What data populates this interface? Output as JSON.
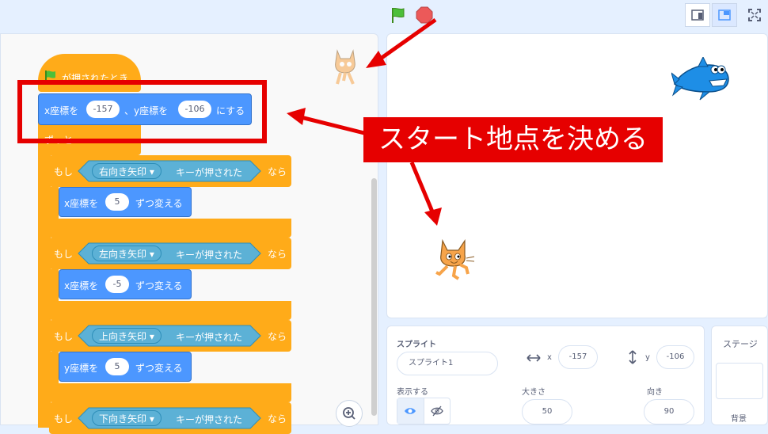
{
  "toolbar": {
    "flag_icon": "green-flag-icon",
    "stop_icon": "stop-icon",
    "small_stage_icon": "small-stage-icon",
    "large_stage_icon": "large-stage-icon",
    "fullscreen_icon": "fullscreen-icon"
  },
  "script": {
    "hat_label": "が押されたとき",
    "goto": {
      "prefix": "x座標を",
      "x": "-157",
      "mid": "、y座標を",
      "y": "-106",
      "suffix": "にする"
    },
    "forever_label": "ずっと",
    "ifs": [
      {
        "if": "もし",
        "key": "右向き矢印",
        "pressed": "キーが押された",
        "then": "なら",
        "action": "x座標を",
        "value": "5",
        "action_suffix": "ずつ変える"
      },
      {
        "if": "もし",
        "key": "左向き矢印",
        "pressed": "キーが押された",
        "then": "なら",
        "action": "x座標を",
        "value": "-5",
        "action_suffix": "ずつ変える"
      },
      {
        "if": "もし",
        "key": "上向き矢印",
        "pressed": "キーが押された",
        "then": "なら",
        "action": "y座標を",
        "value": "5",
        "action_suffix": "ずつ変える"
      },
      {
        "if": "もし",
        "key": "下向き矢印",
        "pressed": "キーが押された",
        "then": "なら"
      }
    ]
  },
  "annotation": {
    "text": "スタート地点を決める"
  },
  "sprite_panel": {
    "title": "スプライト",
    "name": "スプライト1",
    "x_label": "x",
    "x_value": "-157",
    "y_label": "y",
    "y_value": "-106",
    "show_label": "表示する",
    "size_label": "大きさ",
    "size_value": "50",
    "direction_label": "向き",
    "direction_value": "90"
  },
  "stage_panel": {
    "title": "ステージ",
    "backdrop_label": "背景"
  },
  "colors": {
    "motion": "#4c97ff",
    "control": "#ffab19",
    "sensing": "#5cb1d6",
    "highlight": "#e60000"
  }
}
